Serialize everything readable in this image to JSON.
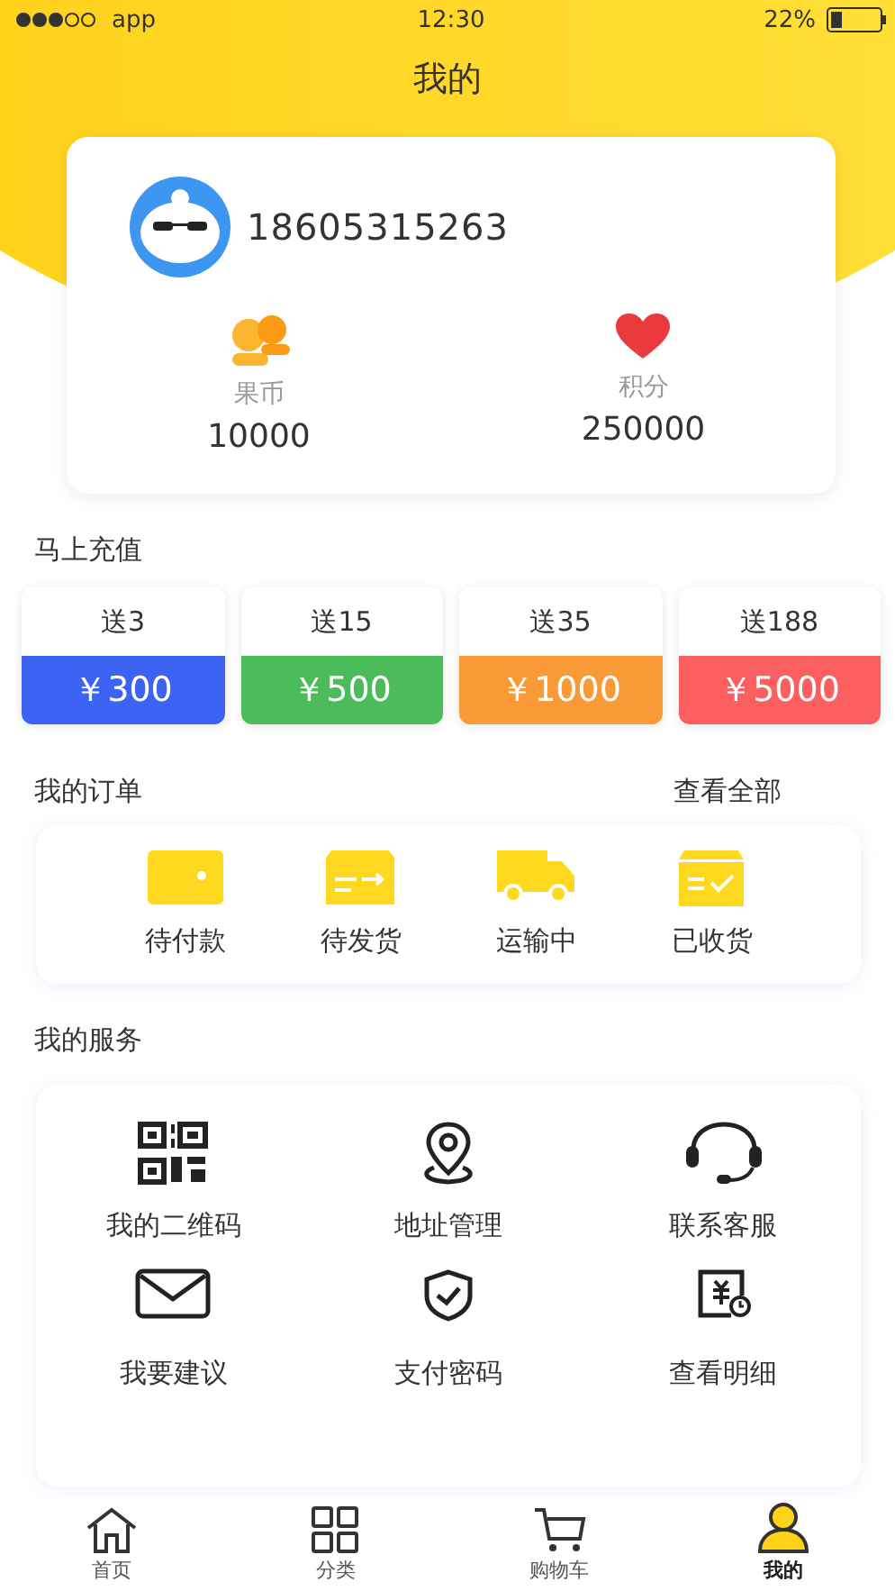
{
  "status_bar": {
    "carrier": "app",
    "time": "12:30",
    "battery": "22%"
  },
  "title": "我的",
  "profile": {
    "phone": "18605315263",
    "stats": [
      {
        "kind": "coins",
        "label": "果币",
        "value": "10000"
      },
      {
        "kind": "heart",
        "label": "积分",
        "value": "250000"
      }
    ]
  },
  "recharge": {
    "title": "马上充值",
    "options": [
      {
        "bonus": "送3",
        "price": "￥300",
        "color": "#3d63f5"
      },
      {
        "bonus": "送15",
        "price": "￥500",
        "color": "#4cbc5a"
      },
      {
        "bonus": "送35",
        "price": "￥1000",
        "color": "#fa9a36"
      },
      {
        "bonus": "送188",
        "price": "￥5000",
        "color": "#fc5f5f"
      }
    ]
  },
  "orders": {
    "title": "我的订单",
    "view_all": "查看全部",
    "items": [
      {
        "kind": "wallet",
        "label": "待付款"
      },
      {
        "kind": "ship",
        "label": "待发货"
      },
      {
        "kind": "truck",
        "label": "运输中"
      },
      {
        "kind": "box",
        "label": "已收货"
      }
    ]
  },
  "services": {
    "title": "我的服务",
    "items": [
      {
        "kind": "qr",
        "label": "我的二维码"
      },
      {
        "kind": "pin",
        "label": "地址管理"
      },
      {
        "kind": "headset",
        "label": "联系客服"
      },
      {
        "kind": "mail",
        "label": "我要建议"
      },
      {
        "kind": "shield",
        "label": "支付密码"
      },
      {
        "kind": "bill",
        "label": "查看明细"
      }
    ]
  },
  "tabs": [
    {
      "kind": "home",
      "label": "首页",
      "selected": false
    },
    {
      "kind": "grid",
      "label": "分类",
      "selected": false
    },
    {
      "kind": "cart",
      "label": "购物车",
      "selected": false
    },
    {
      "kind": "user",
      "label": "我的",
      "selected": true
    }
  ]
}
